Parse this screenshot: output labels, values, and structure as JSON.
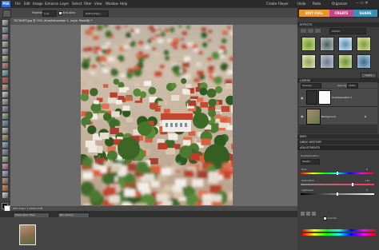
{
  "menubar": {
    "logo": "PSE",
    "items": [
      "File",
      "Edit",
      "Image",
      "Enhance",
      "Layer",
      "Select",
      "Filter",
      "View",
      "Window",
      "Help"
    ],
    "right_buttons": [
      "Create Fileyer",
      "Undo",
      "Redo",
      "Organizer"
    ]
  },
  "options": {
    "feather_label": "Feather:",
    "feather_value": "0 px",
    "antialias_label": "Anti-alias",
    "refine_label": "Refine Edge..."
  },
  "document": {
    "title": "TILTSHIFT.jpg @ 25% (Hue/Saturation 1, Layer Mask/8) *",
    "status": "25% ⏵ Doc: 1.07M/1.07M"
  },
  "right_tabs": {
    "edit": "EDIT FULL",
    "create": "CREATE",
    "share": "SHARE"
  },
  "effects": {
    "header": "EFFECTS",
    "category": "Artistic",
    "apply": "Apply"
  },
  "layers": {
    "header": "LAYERS",
    "blend_mode": "Overlay",
    "opacity": "100%",
    "items": [
      {
        "name": "Hue/Saturation 1"
      },
      {
        "name": "Background"
      }
    ]
  },
  "panels": {
    "info": "INFO",
    "undo_history": "UNDO HISTORY",
    "adjustments": "ADJUSTMENTS"
  },
  "adjustments": {
    "type": "Hue/Saturation",
    "preset": "Master",
    "hue_label": "Hue:",
    "hue_value": "0",
    "saturation_label": "Saturation:",
    "saturation_value": "+42",
    "lightness_label": "Lightness:",
    "lightness_value": "0",
    "colorize_label": "Colorize"
  },
  "bin": {
    "header": "PROJECT BIN",
    "show_label": "Show Open Files",
    "actions_label": "Bin Actions"
  },
  "colors": {
    "accent_edit": "#e8962a",
    "accent_create": "#c04a86",
    "accent_share": "#3f8db0"
  }
}
